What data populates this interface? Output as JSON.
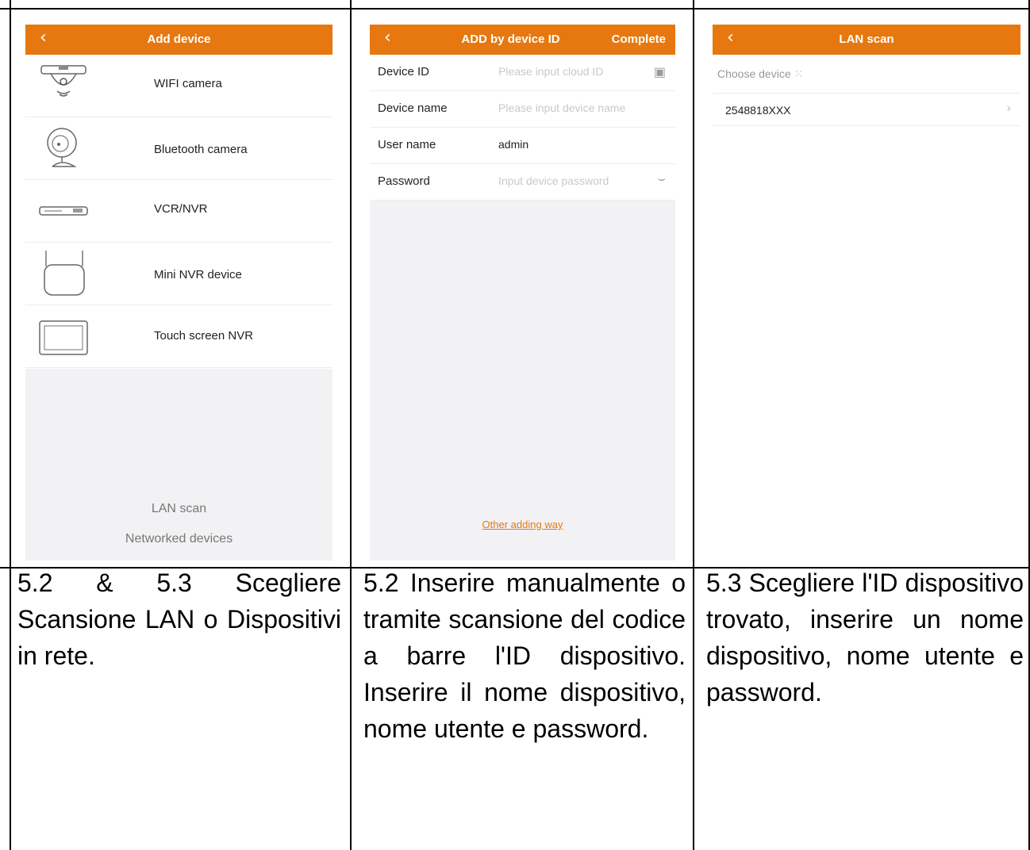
{
  "screen1": {
    "back_icon": "chevron-left-icon",
    "title": "Add device",
    "devices": [
      {
        "label": "WIFI camera",
        "icon": "wifi-camera-icon"
      },
      {
        "label": "Bluetooth camera",
        "icon": "bluetooth-camera-icon"
      },
      {
        "label": "VCR/NVR",
        "icon": "nvr-recorder-icon"
      },
      {
        "label": "Mini NVR device",
        "icon": "mini-nvr-icon"
      },
      {
        "label": "Touch screen NVR",
        "icon": "touch-screen-nvr-icon"
      }
    ],
    "lan_scan": "LAN scan",
    "networked": "Networked devices"
  },
  "screen2": {
    "back_icon": "chevron-left-icon",
    "title": "ADD by device ID",
    "complete": "Complete",
    "fields": [
      {
        "label": "Device ID",
        "placeholder": "Please input cloud ID",
        "value": "",
        "icon": "scan-icon"
      },
      {
        "label": "Device name",
        "placeholder": "Please input device name",
        "value": ""
      },
      {
        "label": "User name",
        "placeholder": "",
        "value": "admin"
      },
      {
        "label": "Password",
        "placeholder": "Input device password",
        "value": "",
        "icon": "eye-closed-icon"
      }
    ],
    "other_way": "Other adding way"
  },
  "screen3": {
    "back_icon": "chevron-left-icon",
    "title": "LAN scan",
    "choose": "Choose device",
    "devices": [
      {
        "id": "2548818XXX"
      }
    ]
  },
  "captions": [
    "5.2 & 5.3 Scegliere Scansione LAN o Dispositivi in rete.",
    "5.2 Inserire manualmente o tramite scansione del codice a barre l'ID dispositivo. Inserire il nome dispositivo, nome utente e password.",
    "5.3 Scegliere l'ID dispositivo trovato, inserire un nome dispositivo, nome utente e password."
  ],
  "colors": {
    "accent": "#e6780f",
    "grey_area": "#f2f2f4"
  }
}
